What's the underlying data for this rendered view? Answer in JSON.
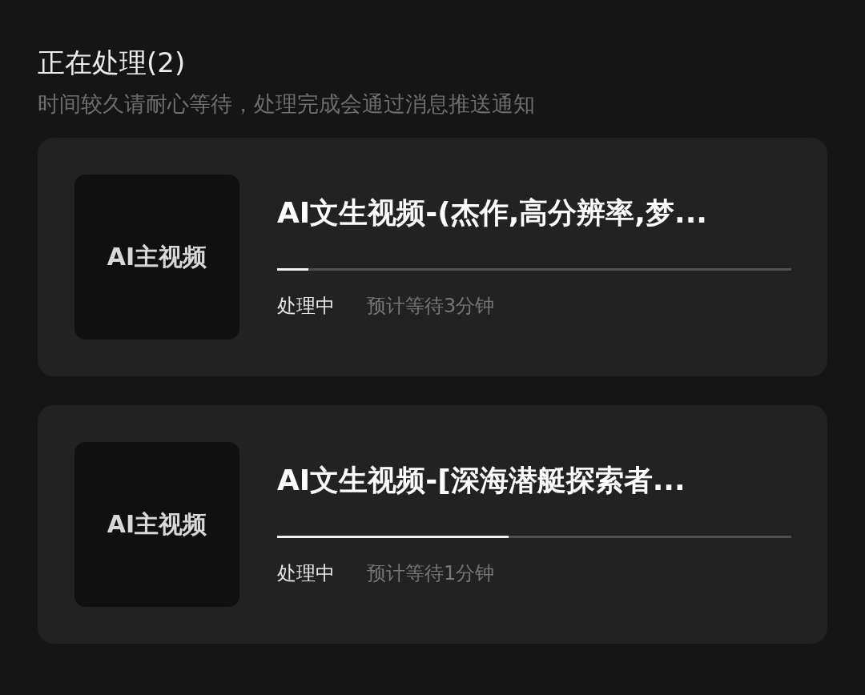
{
  "header": {
    "title": "正在处理(2)",
    "subtitle": "时间较久请耐心等待，处理完成会通过消息推送通知"
  },
  "tasks": [
    {
      "thumbnail_label": "AI主视频",
      "title": "AI文生视频-(杰作,高分辨率,梦...",
      "level": 0.06,
      "status": "处理中",
      "eta": "预计等待3分钟"
    },
    {
      "thumbnail_label": "AI主视频",
      "title": "AI文生视频-[深海潜艇探索者...",
      "level": 0.45,
      "status": "处理中",
      "eta": "预计等待1分钟"
    }
  ]
}
